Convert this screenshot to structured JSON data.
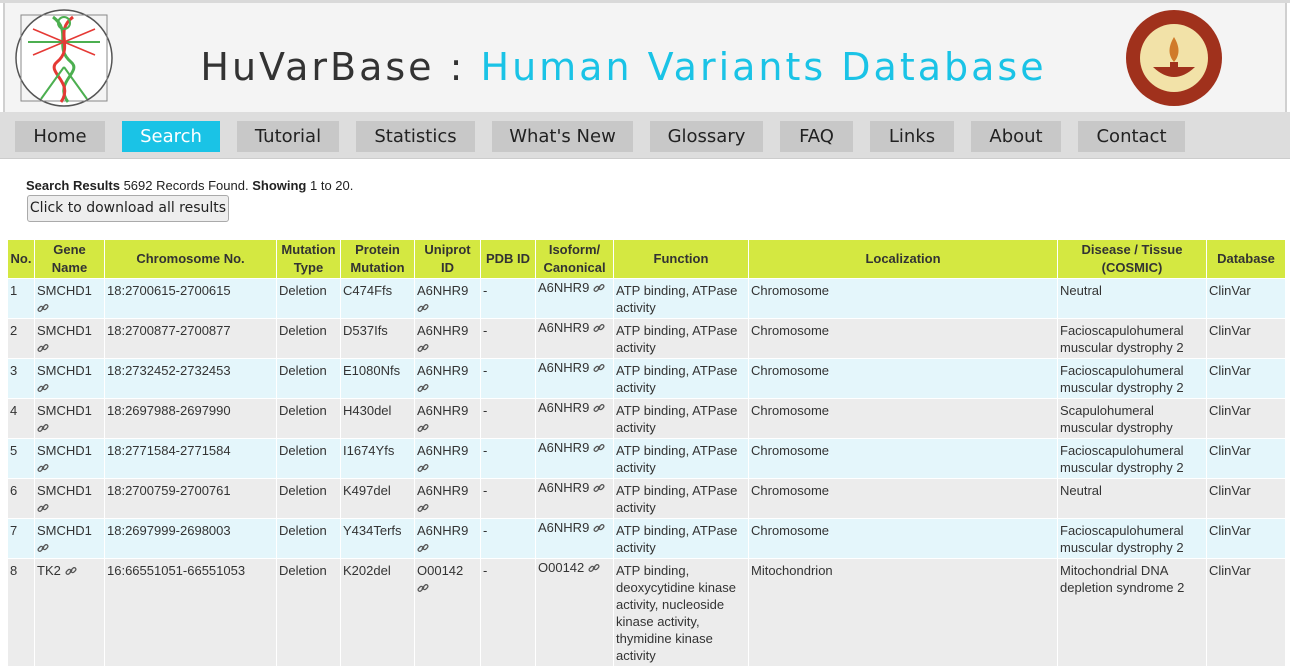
{
  "header": {
    "title_part1": "HuVarBase : ",
    "title_part2": "Human Variants Database",
    "accent_color": "#1ac3e6",
    "left_logo": "vitruvian-dna-logo",
    "right_logo": "iit-madras-seal"
  },
  "nav": [
    {
      "label": "Home"
    },
    {
      "label": "Search",
      "active": true
    },
    {
      "label": "Tutorial"
    },
    {
      "label": "Statistics"
    },
    {
      "label": "What's New"
    },
    {
      "label": "Glossary"
    },
    {
      "label": "FAQ"
    },
    {
      "label": "Links"
    },
    {
      "label": "About"
    },
    {
      "label": "Contact"
    }
  ],
  "summary": {
    "label": "Search Results",
    "records": "5692 Records Found.",
    "showing_label": "Showing",
    "range": "1 to 20."
  },
  "download_button": "Click to download all results",
  "table": {
    "header_color": "#d4e841",
    "columns": [
      "No.",
      "Gene Name",
      "Chromosome No.",
      "Mutation Type",
      "Protein Mutation",
      "Uniprot ID",
      "PDB ID",
      "Isoform/ Canonical",
      "Function",
      "Localization",
      "Disease / Tissue (COSMIC)",
      "Database"
    ],
    "rows": [
      {
        "no": "1",
        "gene": "SMCHD1",
        "chrom": "18:2700615-2700615",
        "mtype": "Deletion",
        "pmut": "C474Ffs",
        "uniprot": "A6NHR9",
        "pdb": "-",
        "isoform": "A6NHR9",
        "function": "ATP binding, ATPase activity",
        "loc": "Chromosome",
        "disease": "Neutral",
        "db": "ClinVar"
      },
      {
        "no": "2",
        "gene": "SMCHD1",
        "chrom": "18:2700877-2700877",
        "mtype": "Deletion",
        "pmut": "D537Ifs",
        "uniprot": "A6NHR9",
        "pdb": "-",
        "isoform": "A6NHR9",
        "function": "ATP binding, ATPase activity",
        "loc": "Chromosome",
        "disease": "Facioscapulohumeral muscular dystrophy 2",
        "db": "ClinVar"
      },
      {
        "no": "3",
        "gene": "SMCHD1",
        "chrom": "18:2732452-2732453",
        "mtype": "Deletion",
        "pmut": "E1080Nfs",
        "uniprot": "A6NHR9",
        "pdb": "-",
        "isoform": "A6NHR9",
        "function": "ATP binding, ATPase activity",
        "loc": "Chromosome",
        "disease": "Facioscapulohumeral muscular dystrophy 2",
        "db": "ClinVar"
      },
      {
        "no": "4",
        "gene": "SMCHD1",
        "chrom": "18:2697988-2697990",
        "mtype": "Deletion",
        "pmut": "H430del",
        "uniprot": "A6NHR9",
        "pdb": "-",
        "isoform": "A6NHR9",
        "function": "ATP binding, ATPase activity",
        "loc": "Chromosome",
        "disease": "Scapulohumeral muscular dystrophy",
        "db": "ClinVar"
      },
      {
        "no": "5",
        "gene": "SMCHD1",
        "chrom": "18:2771584-2771584",
        "mtype": "Deletion",
        "pmut": "I1674Yfs",
        "uniprot": "A6NHR9",
        "pdb": "-",
        "isoform": "A6NHR9",
        "function": "ATP binding, ATPase activity",
        "loc": "Chromosome",
        "disease": "Facioscapulohumeral muscular dystrophy 2",
        "db": "ClinVar"
      },
      {
        "no": "6",
        "gene": "SMCHD1",
        "chrom": "18:2700759-2700761",
        "mtype": "Deletion",
        "pmut": "K497del",
        "uniprot": "A6NHR9",
        "pdb": "-",
        "isoform": "A6NHR9",
        "function": "ATP binding, ATPase activity",
        "loc": "Chromosome",
        "disease": "Neutral",
        "db": "ClinVar"
      },
      {
        "no": "7",
        "gene": "SMCHD1",
        "chrom": "18:2697999-2698003",
        "mtype": "Deletion",
        "pmut": "Y434Terfs",
        "uniprot": "A6NHR9",
        "pdb": "-",
        "isoform": "A6NHR9",
        "function": "ATP binding, ATPase activity",
        "loc": "Chromosome",
        "disease": "Facioscapulohumeral muscular dystrophy 2",
        "db": "ClinVar"
      },
      {
        "no": "8",
        "gene": "TK2",
        "chrom": "16:66551051-66551053",
        "mtype": "Deletion",
        "pmut": "K202del",
        "uniprot": "O00142",
        "pdb": "-",
        "isoform": "O00142",
        "function": "ATP binding, deoxycytidine kinase activity, nucleoside kinase activity, thymidine kinase activity",
        "loc": "Mitochondrion",
        "disease": "Mitochondrial DNA depletion syndrome 2",
        "db": "ClinVar"
      }
    ]
  }
}
